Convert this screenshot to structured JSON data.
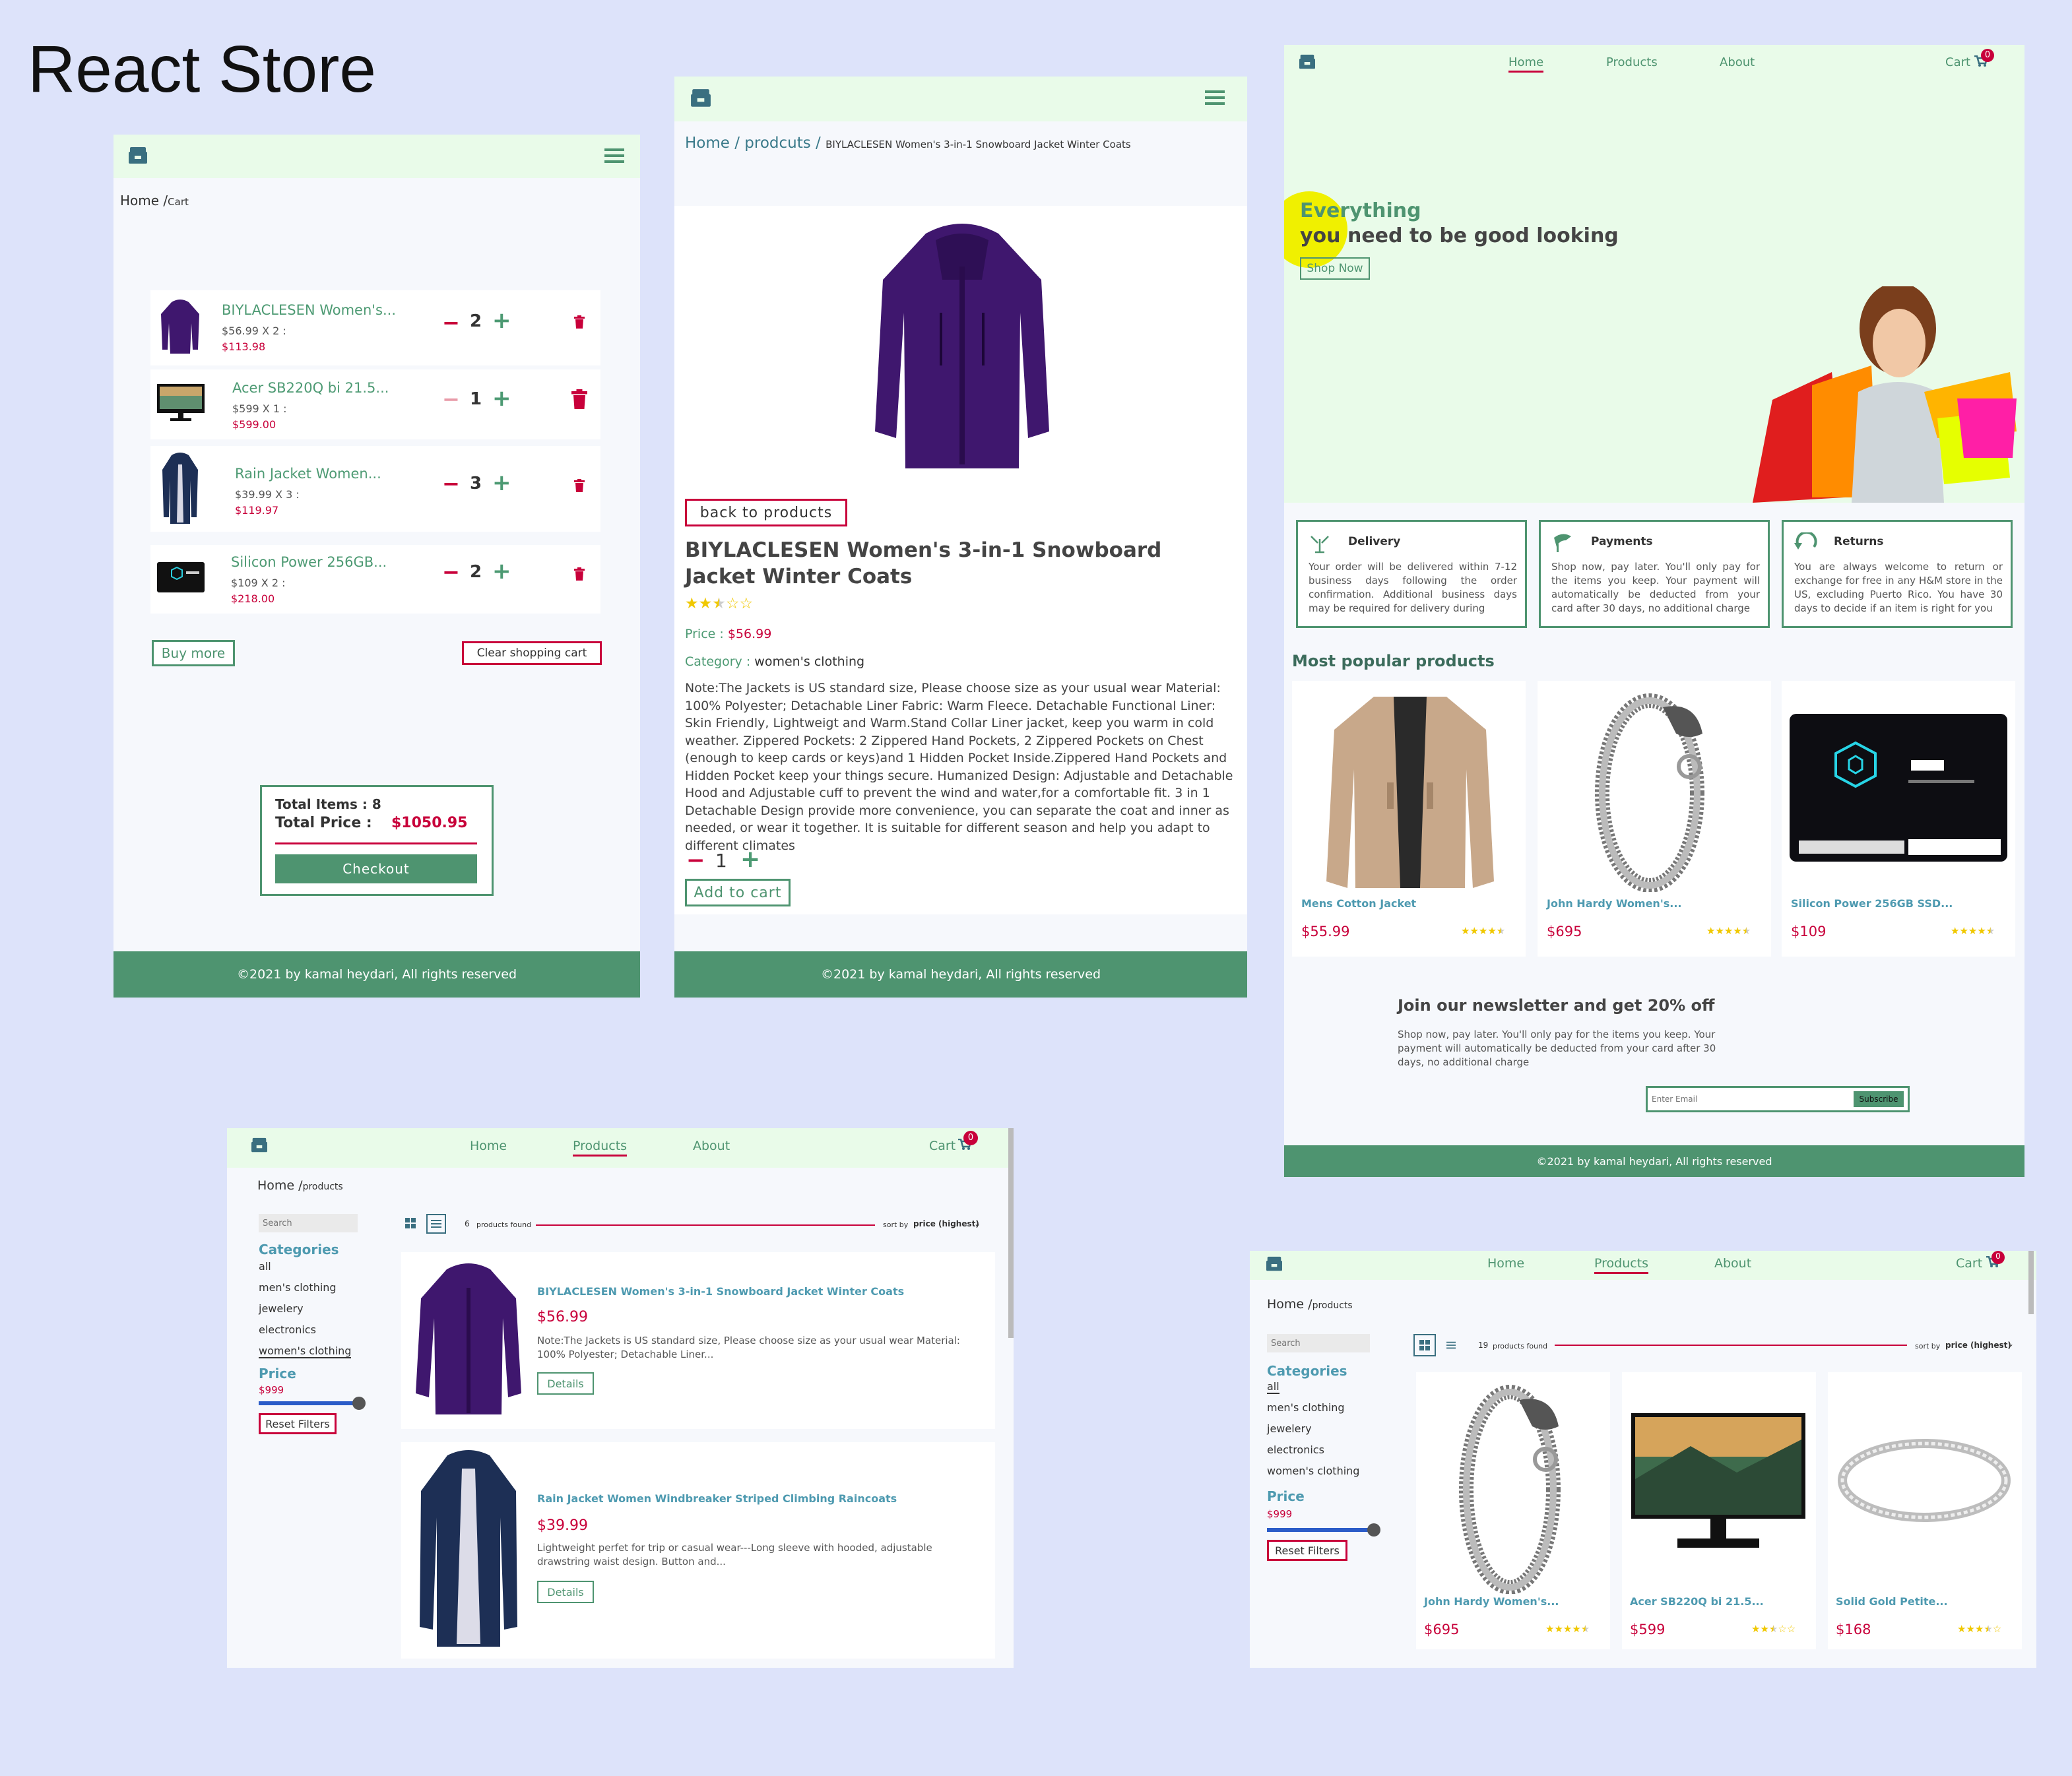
{
  "page_title": "React Store",
  "footer_text": "©2021 by kamal heydari, All rights reserved",
  "cart_view": {
    "breadcrumb_home": "Home",
    "breadcrumb_sep": "/",
    "breadcrumb_current": "Cart",
    "items": [
      {
        "name": "BIYLACLESEN Women's...",
        "line": "$56.99 X 2 :",
        "total": "$113.98",
        "qty": "2"
      },
      {
        "name": "Acer SB220Q bi 21.5...",
        "line": "$599 X 1 :",
        "total": "$599.00",
        "qty": "1"
      },
      {
        "name": "Rain Jacket Women...",
        "line": "$39.99 X 3 :",
        "total": "$119.97",
        "qty": "3"
      },
      {
        "name": "Silicon Power 256GB...",
        "line": "$109 X 2 :",
        "total": "$218.00",
        "qty": "2"
      }
    ],
    "buy_more": "Buy more",
    "clear_cart": "Clear shopping cart",
    "total_items_label": "Total Items : 8",
    "total_price_label": "Total Price :",
    "total_price_value": "$1050.95",
    "checkout": "Checkout"
  },
  "detail_view": {
    "breadcrumb_home": "Home",
    "breadcrumb_products": "prodcuts",
    "breadcrumb_current": "BIYLACLESEN Women's 3-in-1 Snowboard Jacket Winter Coats",
    "back_button": "back to products",
    "title": "BIYLACLESEN Women's 3-in-1 Snowboard Jacket Winter Coats",
    "rating": 2.5,
    "price_label": "Price :",
    "price_value": "$56.99",
    "category_label": "Category :",
    "category_value": "women's clothing",
    "description": "Note:The Jackets is US standard size, Please choose size as your usual wear Material: 100% Polyester; Detachable Liner Fabric: Warm Fleece. Detachable Functional Liner: Skin Friendly, Lightweigt and Warm.Stand Collar Liner jacket, keep you warm in cold weather. Zippered Pockets: 2 Zippered Hand Pockets, 2 Zippered Pockets on Chest (enough to keep cards or keys)and 1 Hidden Pocket Inside.Zippered Hand Pockets and Hidden Pocket keep your things secure. Humanized Design: Adjustable and Detachable Hood and Adjustable cuff to prevent the wind and water,for a comfortable fit. 3 in 1 Detachable Design provide more convenience, you can separate the coat and inner as needed, or wear it together. It is suitable for different season and help you adapt to different climates",
    "qty": "1",
    "add_to_cart": "Add to cart"
  },
  "home_view": {
    "nav": {
      "home": "Home",
      "products": "Products",
      "about": "About",
      "cart": "Cart",
      "cart_count": "0"
    },
    "hero_line1": "Everything",
    "hero_line2": "you need to be good looking",
    "shop_now": "Shop Now",
    "features": [
      {
        "title": "Delivery",
        "text": "Your order will be delivered within 7-12 business days following the order confirmation. Additional business days may be required for delivery during"
      },
      {
        "title": "Payments",
        "text": "Shop now, pay later. You'll only pay for the items you keep. Your payment will automatically be deducted from your card after 30 days, no additional charge"
      },
      {
        "title": "Returns",
        "text": "You are always welcome to return or exchange for free in any H&M store in the US, excluding Puerto Rico. You have 30 days to decide if an item is right for you"
      }
    ],
    "popular_heading": "Most popular products",
    "popular": [
      {
        "name": "Mens Cotton Jacket",
        "price": "$55.99",
        "rating": 4.5
      },
      {
        "name": "John Hardy Women's...",
        "price": "$695",
        "rating": 4.5
      },
      {
        "name": "Silicon Power 256GB SSD...",
        "price": "$109",
        "rating": 4.5
      }
    ],
    "newsletter_title": "Join our newsletter and get 20% off",
    "newsletter_text": "Shop now, pay later. You'll only pay for the items you keep. Your payment will automatically be deducted from your card after 30 days, no additional charge",
    "email_placeholder": "Enter Email",
    "subscribe": "Subscribe"
  },
  "list_view": {
    "nav": {
      "home": "Home",
      "products": "Products",
      "about": "About",
      "cart": "Cart",
      "cart_count": "0"
    },
    "breadcrumb_home": "Home",
    "breadcrumb_current": "products",
    "search_placeholder": "Search",
    "categories_heading": "Categories",
    "categories": [
      "all",
      "men's clothing",
      "jewelery",
      "electronics",
      "women's clothing"
    ],
    "price_heading": "Price",
    "price_value": "$999",
    "reset": "Reset Filters",
    "found_count": "6",
    "found_text": "products found",
    "sort_label": "sort by",
    "sort_value": "price (highest)",
    "products": [
      {
        "name": "BIYLACLESEN Women's 3-in-1 Snowboard Jacket Winter Coats",
        "price": "$56.99",
        "desc": "Note:The Jackets is US standard size, Please choose size as your usual wear Material: 100% Polyester; Detachable Liner...",
        "details": "Details"
      },
      {
        "name": "Rain Jacket Women Windbreaker Striped Climbing Raincoats",
        "price": "$39.99",
        "desc": "Lightweight perfet for trip or casual wear---Long sleeve with hooded, adjustable drawstring waist design. Button and...",
        "details": "Details"
      }
    ]
  },
  "grid_view": {
    "nav": {
      "home": "Home",
      "products": "Products",
      "about": "About",
      "cart": "Cart",
      "cart_count": "0"
    },
    "breadcrumb_home": "Home",
    "breadcrumb_current": "products",
    "search_placeholder": "Search",
    "categories_heading": "Categories",
    "categories": [
      "all",
      "men's clothing",
      "jewelery",
      "electronics",
      "women's clothing"
    ],
    "price_heading": "Price",
    "price_value": "$999",
    "reset": "Reset Filters",
    "found_count": "19",
    "found_text": "products found",
    "sort_label": "sort by",
    "sort_value": "price (highest)",
    "products": [
      {
        "name": "John Hardy Women's...",
        "price": "$695",
        "rating": 4.5
      },
      {
        "name": "Acer SB220Q bi 21.5...",
        "price": "$599",
        "rating": 2.5
      },
      {
        "name": "Solid Gold Petite...",
        "price": "$168",
        "rating": 3.5
      }
    ]
  },
  "colors": {
    "accent_green": "#4e9470",
    "accent_red": "#c8003a",
    "nav_bg": "#e9fbe9",
    "page_bg": "#dde3fa"
  }
}
